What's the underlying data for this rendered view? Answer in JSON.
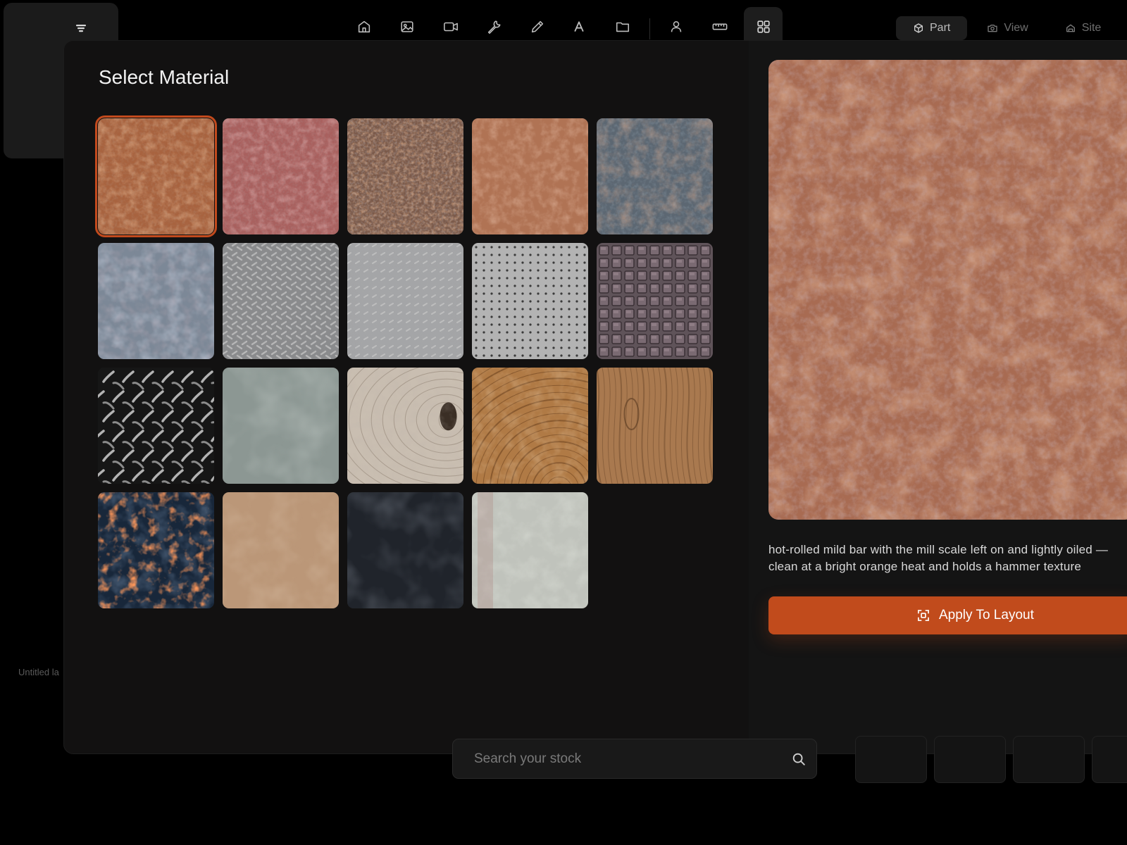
{
  "sidebar": {
    "menu_icon": "menu-lines-icon",
    "file_label": "Untitled la"
  },
  "toolbar": {
    "tools": [
      {
        "name": "home",
        "icon": "home-icon"
      },
      {
        "name": "image",
        "icon": "image-icon"
      },
      {
        "name": "video",
        "icon": "video-camera-icon"
      },
      {
        "name": "wrench",
        "icon": "wrench-icon"
      },
      {
        "name": "pencil",
        "icon": "pencil-icon"
      },
      {
        "name": "text",
        "icon": "text-icon"
      },
      {
        "name": "folder",
        "icon": "folder-icon"
      },
      {
        "name": "user",
        "icon": "user-icon"
      },
      {
        "name": "ruler",
        "icon": "ruler-icon"
      },
      {
        "name": "grid",
        "icon": "grid-icon",
        "active": true
      }
    ]
  },
  "view_tabs": [
    {
      "label": "Part",
      "icon": "cube-icon",
      "active": true
    },
    {
      "label": "View",
      "icon": "camera-icon",
      "active": false
    },
    {
      "label": "Site",
      "icon": "house-icon",
      "active": false
    }
  ],
  "panel": {
    "title": "Select Material"
  },
  "materials": [
    {
      "kind": "rust-orange",
      "selected": true
    },
    {
      "kind": "rust-pink"
    },
    {
      "kind": "rust-speckled"
    },
    {
      "kind": "rust-light"
    },
    {
      "kind": "rust-blue-patina"
    },
    {
      "kind": "galvanized"
    },
    {
      "kind": "tread-plate-fine"
    },
    {
      "kind": "tread-plate-light"
    },
    {
      "kind": "perforated-dots"
    },
    {
      "kind": "waffle-grid"
    },
    {
      "kind": "diamond-plate-dark"
    },
    {
      "kind": "grey-slate"
    },
    {
      "kind": "wood-knot-light"
    },
    {
      "kind": "wood-end-grain"
    },
    {
      "kind": "wood-oak"
    },
    {
      "kind": "embers"
    },
    {
      "kind": "tan-leather"
    },
    {
      "kind": "dark-slate"
    },
    {
      "kind": "concrete-rust-streak"
    }
  ],
  "preview": {
    "description": "hot-rolled mild bar with the mill scale left on and lightly oiled — clean at a bright orange heat and holds a hammer texture",
    "apply_label": "Apply To Layout",
    "apply_icon": "apply-focus-icon"
  },
  "search": {
    "placeholder": "Search your stock",
    "icon": "search-icon"
  },
  "colors": {
    "accent": "#c14b1c",
    "panel": "#121111",
    "background": "#000000"
  }
}
